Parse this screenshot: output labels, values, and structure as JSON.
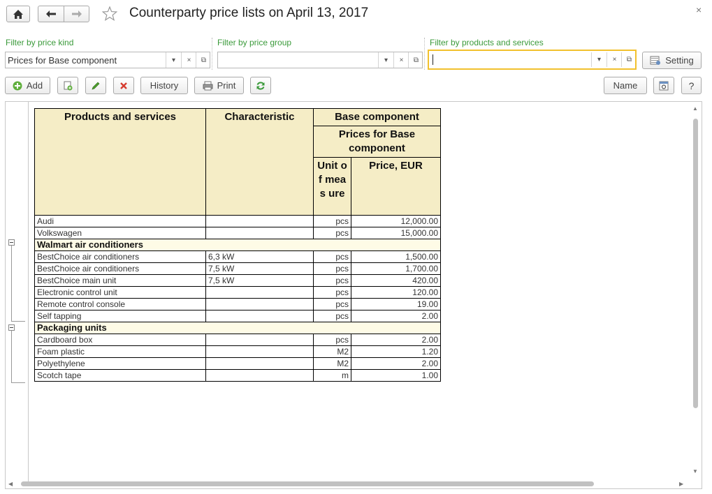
{
  "window": {
    "title": "Counterparty price lists on April 13, 2017",
    "close": "×"
  },
  "filters": {
    "price_kind_label": "Filter by price kind",
    "price_kind_value": "Prices for Base component",
    "price_group_label": "Filter by price group",
    "price_group_value": "",
    "products_label": "Filter by products and services",
    "products_value": "",
    "setting_label": "Setting"
  },
  "toolbar": {
    "add_label": "Add",
    "history_label": "History",
    "print_label": "Print",
    "name_label": "Name",
    "help_label": "?"
  },
  "table": {
    "headers": {
      "products": "Products and services",
      "characteristic": "Characteristic",
      "base_component": "Base component",
      "prices_for": "Prices for Base component",
      "unit": "Unit of meas ure",
      "price": "Price, EUR"
    },
    "rows": [
      {
        "name": "Audi",
        "char": "",
        "unit": "pcs",
        "price": "12,000.00"
      },
      {
        "name": "Volkswagen",
        "char": "",
        "unit": "pcs",
        "price": "15,000.00"
      },
      {
        "group": "Walmart air conditioners"
      },
      {
        "name": "BestChoice air conditioners",
        "char": "6,3 kW",
        "unit": "pcs",
        "price": "1,500.00"
      },
      {
        "name": "BestChoice air conditioners",
        "char": "7,5 kW",
        "unit": "pcs",
        "price": "1,700.00"
      },
      {
        "name": "BestChoice main unit",
        "char": "7,5 kW",
        "unit": "pcs",
        "price": "420.00"
      },
      {
        "name": "Electronic control unit",
        "char": "",
        "unit": "pcs",
        "price": "120.00"
      },
      {
        "name": "Remote control console",
        "char": "",
        "unit": "pcs",
        "price": "19.00"
      },
      {
        "name": "Self tapping",
        "char": "",
        "unit": "pcs",
        "price": "2.00"
      },
      {
        "group": "Packaging units"
      },
      {
        "name": "Cardboard box",
        "char": "",
        "unit": "pcs",
        "price": "2.00"
      },
      {
        "name": "Foam plastic",
        "char": "",
        "unit": "M2",
        "price": "1.20"
      },
      {
        "name": "Polyethylene",
        "char": "",
        "unit": "M2",
        "price": "2.00"
      },
      {
        "name": "Scotch tape",
        "char": "",
        "unit": "m",
        "price": "1.00"
      }
    ]
  }
}
